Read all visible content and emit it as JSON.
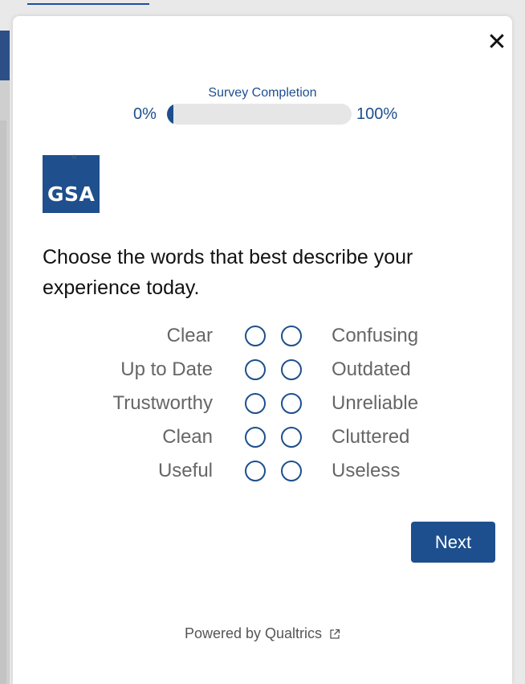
{
  "modal": {
    "close_symbol": "✕",
    "progress": {
      "title": "Survey Completion",
      "start_label": "0%",
      "end_label": "100%",
      "value": 0
    },
    "logo_text": "GSA",
    "logo_reg": "®",
    "question": "Choose the words that best describe your experience today.",
    "pairs": [
      {
        "positive": "Clear",
        "negative": "Confusing"
      },
      {
        "positive": "Up to Date",
        "negative": "Outdated"
      },
      {
        "positive": "Trustworthy",
        "negative": "Unreliable"
      },
      {
        "positive": "Clean",
        "negative": "Cluttered"
      },
      {
        "positive": "Useful",
        "negative": "Useless"
      }
    ],
    "next_label": "Next",
    "footer_label": "Powered by Qualtrics",
    "footer_icon": "external-link-icon"
  },
  "colors": {
    "accent": "#1d4f8e",
    "label_gray": "#666666",
    "overlay_bg": "#e9e9e9"
  }
}
